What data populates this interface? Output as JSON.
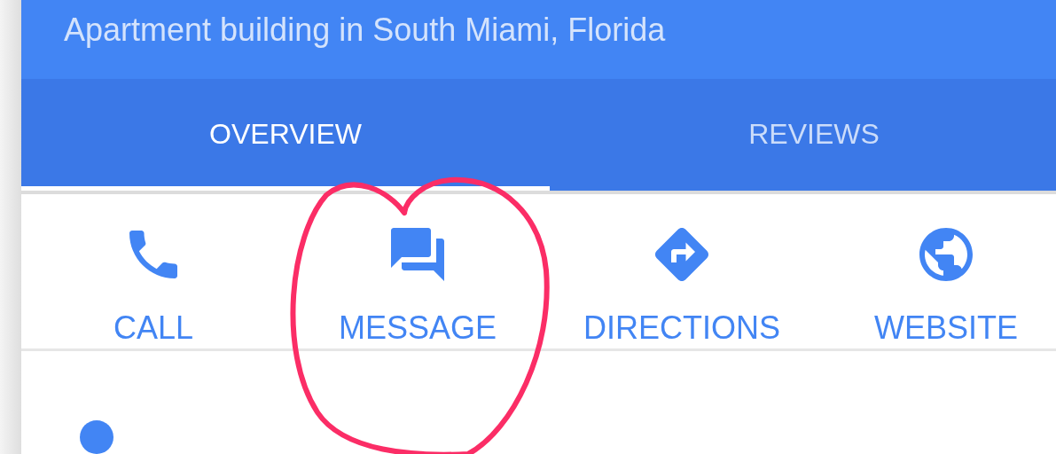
{
  "header": {
    "subtitle": "Apartment building in South Miami, Florida"
  },
  "tabs": [
    {
      "label": "OVERVIEW",
      "selected": true
    },
    {
      "label": "REVIEWS",
      "selected": false
    }
  ],
  "actions": [
    {
      "kind": "call",
      "label": "CALL"
    },
    {
      "kind": "message",
      "label": "MESSAGE"
    },
    {
      "kind": "directions",
      "label": "DIRECTIONS"
    },
    {
      "kind": "website",
      "label": "WEBSITE"
    }
  ]
}
